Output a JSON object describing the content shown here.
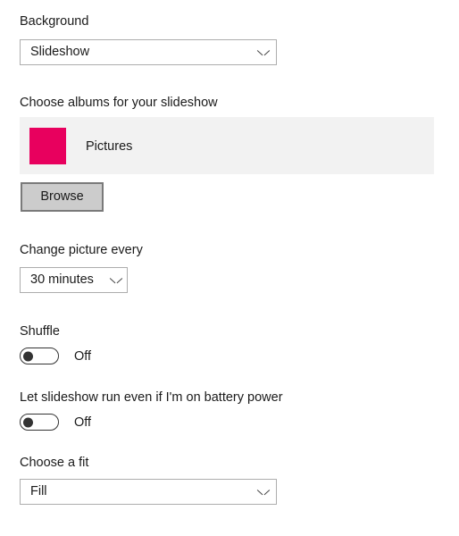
{
  "background_section": {
    "label": "Background",
    "dropdown": {
      "value": "Slideshow",
      "icon": "chevron-down-icon"
    }
  },
  "albums_section": {
    "label": "Choose albums for your slideshow",
    "items": [
      {
        "name": "Pictures",
        "thumbnail_color": "#e8005e"
      }
    ],
    "browse_button": "Browse"
  },
  "interval_section": {
    "label": "Change picture every",
    "dropdown": {
      "value": "30 minutes",
      "icon": "chevron-down-icon"
    }
  },
  "shuffle_section": {
    "label": "Shuffle",
    "toggle": {
      "state": "Off",
      "checked": false
    }
  },
  "battery_section": {
    "label": "Let slideshow run even if I'm on battery power",
    "toggle": {
      "state": "Off",
      "checked": false
    }
  },
  "fit_section": {
    "label": "Choose a fit",
    "dropdown": {
      "value": "Fill",
      "icon": "chevron-down-icon"
    }
  },
  "colors": {
    "page_background": "#ffffff",
    "text": "#1a1a1a",
    "combo_border": "#adadad",
    "panel_background": "#f2f2f2",
    "button_face": "#cccccc",
    "button_border": "#7a7a7a",
    "toggle_outline": "#333333",
    "accent_thumbnail": "#e8005e"
  }
}
